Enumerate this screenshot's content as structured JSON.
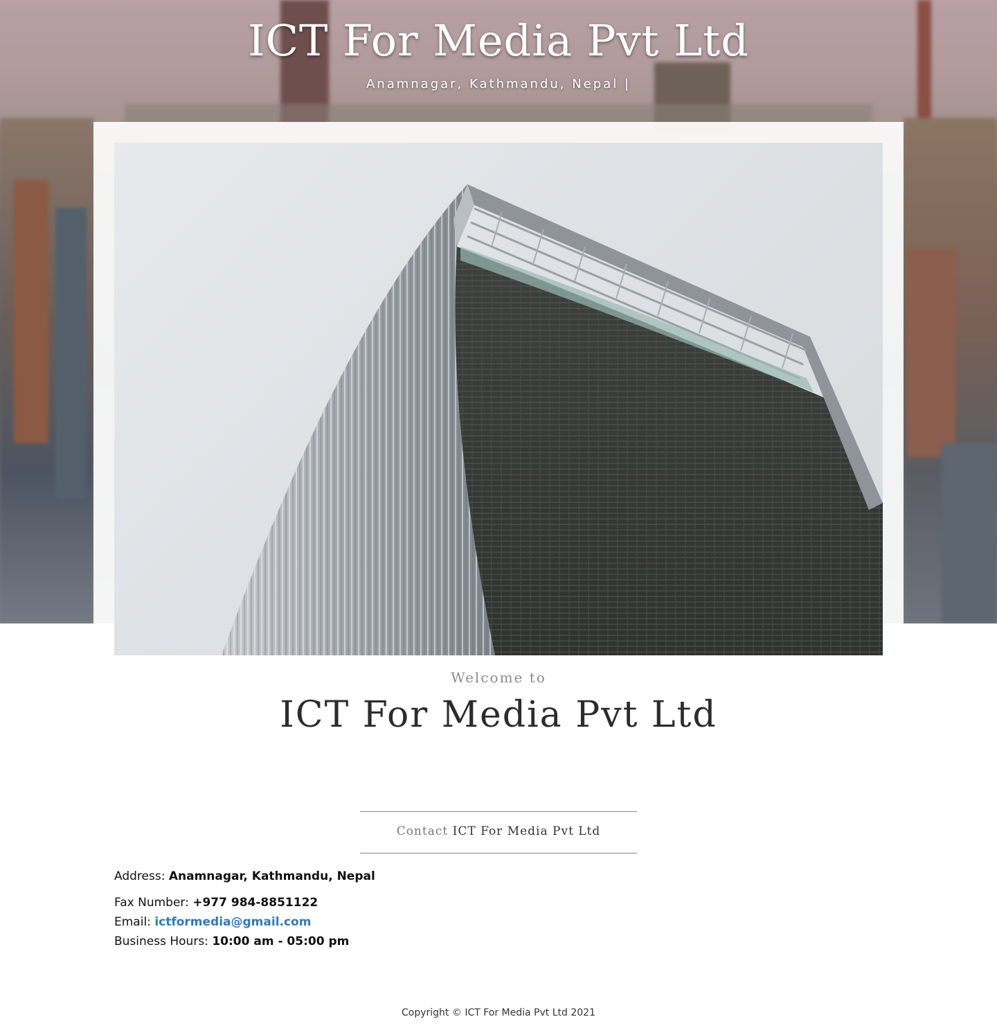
{
  "header": {
    "site_title": "ICT For Media Pvt Ltd",
    "tagline": "Anamnagar, Kathmandu, Nepal |"
  },
  "intro": {
    "welcome": "Welcome to",
    "title": "ICT For Media Pvt Ltd"
  },
  "contact": {
    "heading_prefix": "Contact",
    "heading_name": "ICT For Media Pvt Ltd",
    "address_label": "Address:",
    "address_value": "Anamnagar, Kathmandu, Nepal",
    "fax_label": "Fax Number:",
    "fax_value": "+977 984-8851122",
    "email_label": "Email:",
    "email_value": "ictformedia@gmail.com",
    "hours_label": "Business Hours:",
    "hours_value": "10:00 am - 05:00 pm"
  },
  "footer": {
    "copyright": "Copyright © ICT For Media Pvt Ltd 2021"
  },
  "colors": {
    "link": "#337ab7",
    "title_dark": "#2c2c2c",
    "rule": "#8a8a8a"
  }
}
